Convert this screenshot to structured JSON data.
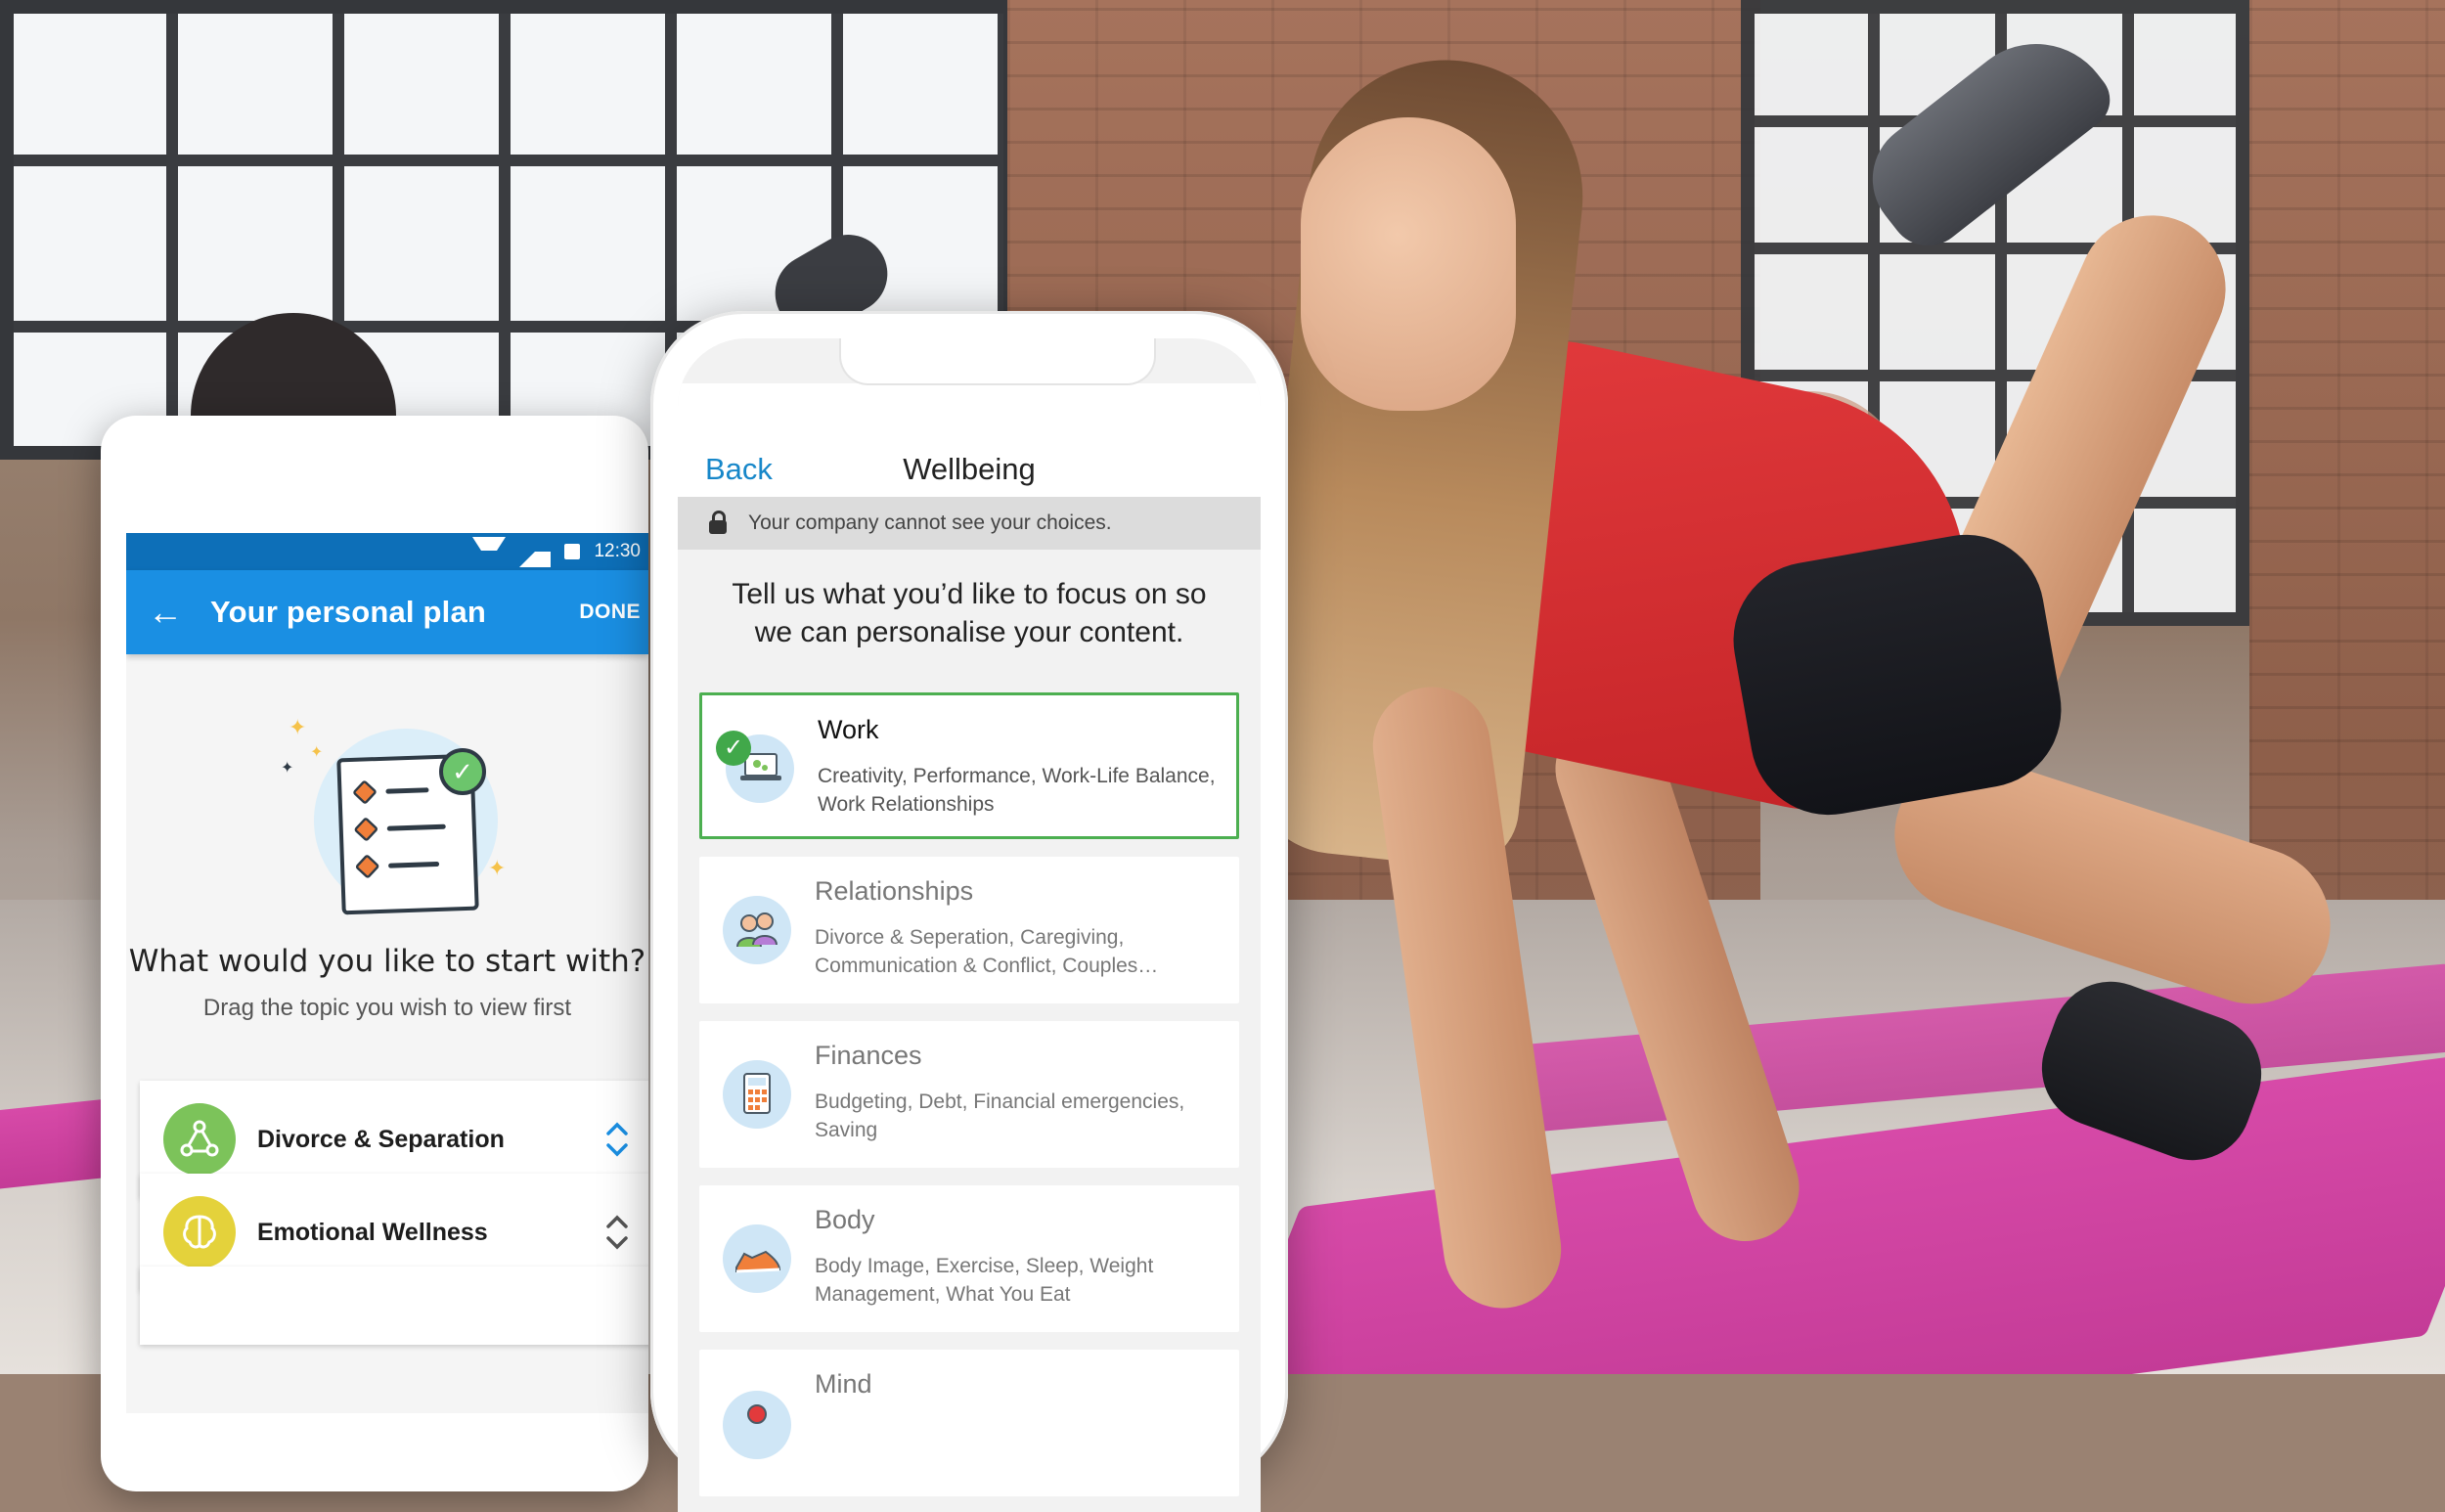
{
  "android": {
    "status_time": "12:30",
    "app_bar": {
      "back_icon": "←",
      "title": "Your personal plan",
      "done_label": "DONE"
    },
    "question": "What would you like to start with?",
    "hint": "Drag the topic you wish to view first",
    "topics": [
      {
        "label": "Divorce & Separation",
        "icon": "people-network-icon",
        "color": "#7cc35a",
        "sorter_color": "#1a8fe3"
      },
      {
        "label": "Emotional Wellness",
        "icon": "brain-icon",
        "color": "#e4d23b",
        "sorter_color": "#555555"
      }
    ]
  },
  "iphone": {
    "nav": {
      "back_label": "Back",
      "title": "Wellbeing"
    },
    "privacy_note": "Your company cannot see your choices.",
    "focus_question": "Tell us what you’d like to focus on so we can personalise your content.",
    "categories": [
      {
        "title": "Work",
        "description": "Creativity, Performance, Work-Life Balance, Work Relationships",
        "selected": true,
        "icon": "laptop-icon"
      },
      {
        "title": "Relationships",
        "description": "Divorce & Seperation,  Caregiving, Communication & Conflict, Couples…",
        "selected": false,
        "icon": "people-icon"
      },
      {
        "title": "Finances",
        "description": "Budgeting, Debt, Financial emergencies, Saving",
        "selected": false,
        "icon": "calculator-icon"
      },
      {
        "title": "Body",
        "description": "Body Image, Exercise, Sleep, Weight Management, What You Eat",
        "selected": false,
        "icon": "sneaker-icon"
      },
      {
        "title": "Mind",
        "description": "",
        "selected": false,
        "icon": "mind-icon"
      }
    ]
  },
  "colors": {
    "android_primary": "#1a8fe3",
    "android_status": "#0d6fb8",
    "ios_link": "#1787c9",
    "selected_border": "#4caf50"
  }
}
